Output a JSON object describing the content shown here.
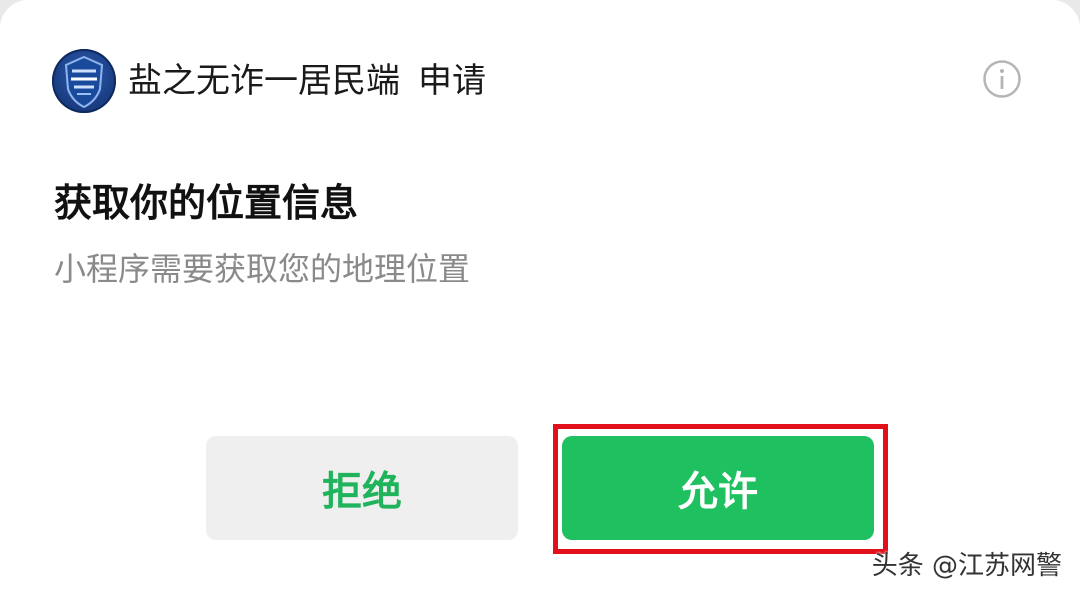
{
  "header": {
    "app_name": "盐之无诈一居民端",
    "request_label": "申请",
    "logo_icon": "police-shield-logo",
    "info_icon": "info-icon"
  },
  "permission": {
    "title": "获取你的位置信息",
    "description": "小程序需要获取您的地理位置"
  },
  "actions": {
    "deny_label": "拒绝",
    "allow_label": "允许"
  },
  "colors": {
    "accent_green": "#1ec05f",
    "highlight_red": "#e1101b",
    "deny_bg": "#efefef"
  },
  "watermark": "头条 @江苏网警"
}
